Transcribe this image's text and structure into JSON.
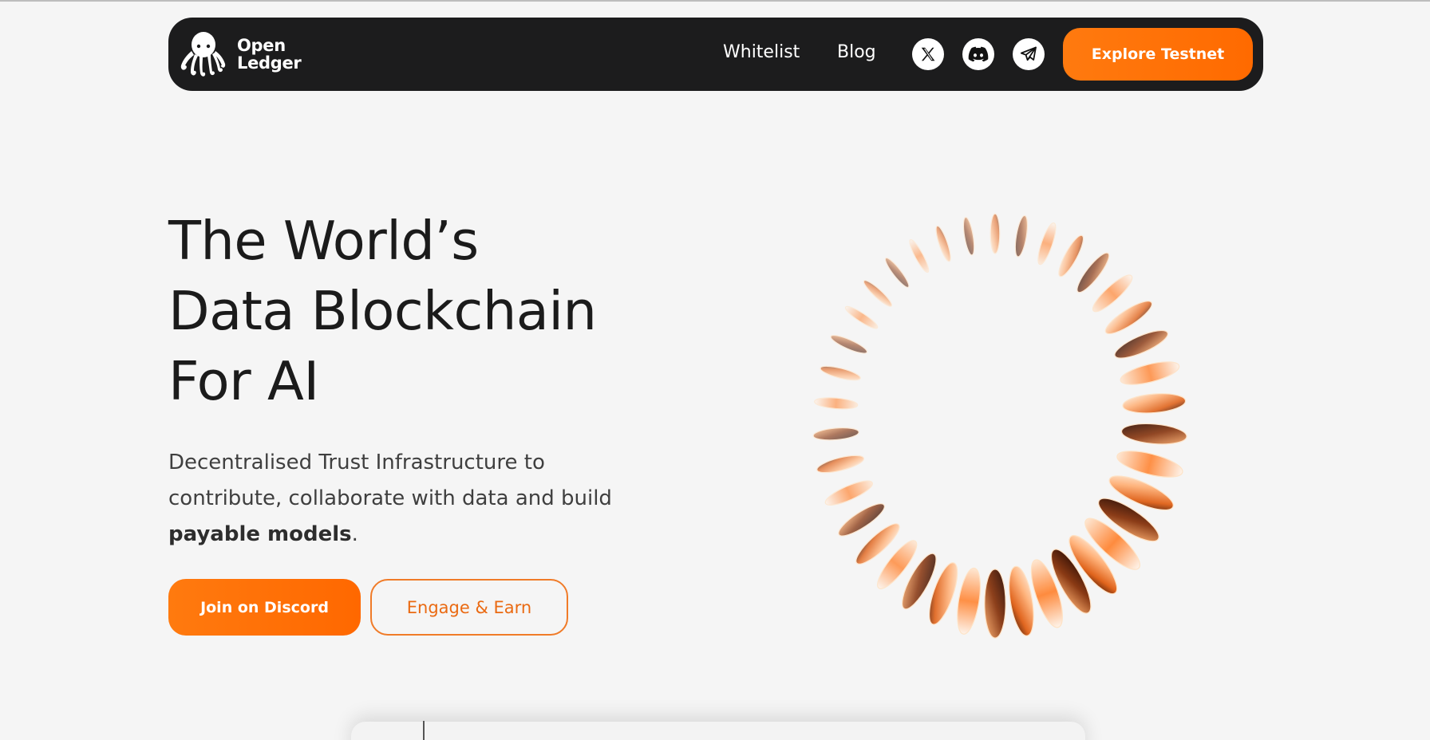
{
  "brand": {
    "name_line1": "Open",
    "name_line2": "Ledger",
    "logo_icon": "octopus-icon"
  },
  "nav": {
    "links": [
      {
        "label": "Whitelist"
      },
      {
        "label": "Blog"
      }
    ],
    "socials": [
      {
        "icon": "x-icon"
      },
      {
        "icon": "discord-icon"
      },
      {
        "icon": "telegram-icon"
      }
    ],
    "cta_label": "Explore Testnet"
  },
  "hero": {
    "title_lines": [
      "The World’s",
      "Data Blockchain",
      "For AI"
    ],
    "subtitle_prefix": "Decentralised Trust Infrastructure to contribute, collaborate with data and build ",
    "subtitle_bold": "payable models",
    "subtitle_suffix": ".",
    "primary_button": "Join on Discord",
    "secondary_button": "Engage & Earn",
    "art_icon": "orange-ring-art"
  },
  "colors": {
    "accent": "#ff6e05",
    "nav_background": "#1c1c1d",
    "page_background": "#f5f5f5",
    "text_dark": "#1b1b1b"
  }
}
